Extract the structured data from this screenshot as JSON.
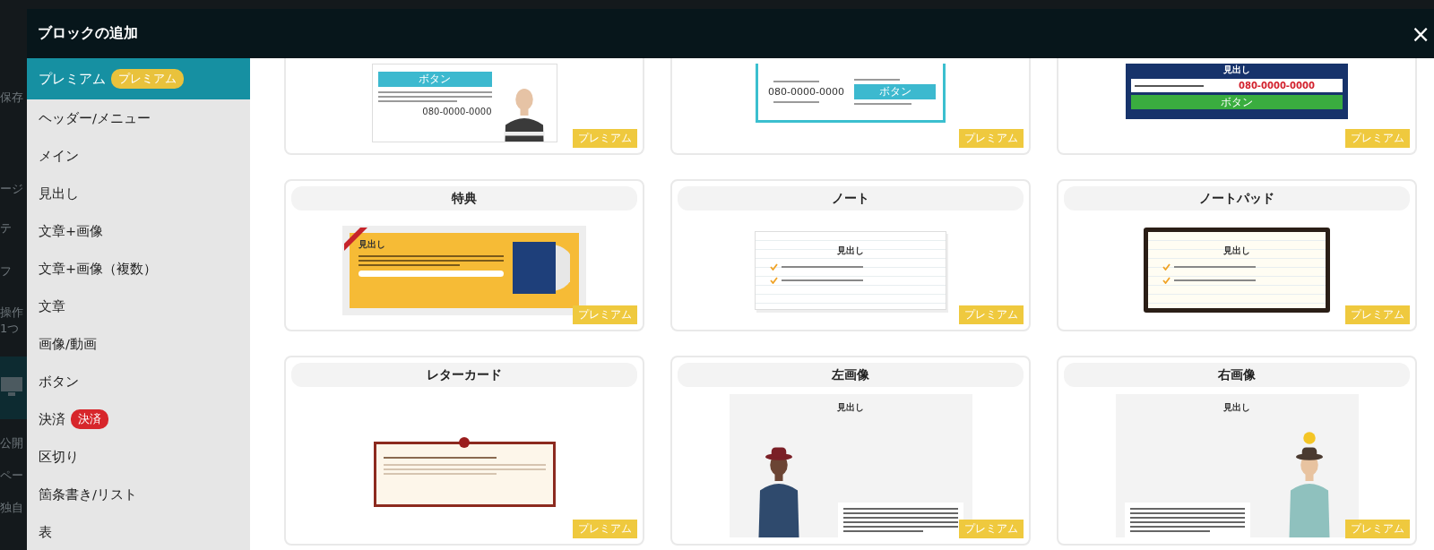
{
  "background_sidebar": {
    "items": [
      {
        "label": "保存"
      },
      {
        "label": "ージ"
      },
      {
        "label": "テ"
      },
      {
        "label": "フ"
      },
      {
        "label": "操作"
      },
      {
        "label": "1つ"
      },
      {
        "label": "公開"
      },
      {
        "label": "ペー"
      },
      {
        "label": "独自"
      }
    ]
  },
  "modal": {
    "title": "ブロックの追加",
    "close": "×"
  },
  "sidebar": {
    "items": [
      {
        "label": "プレミアム",
        "selected": true,
        "badge": {
          "text": "プレミアム",
          "color": "#e9c23c"
        }
      },
      {
        "label": "ヘッダー/メニュー",
        "selected": false
      },
      {
        "label": "メイン",
        "selected": false
      },
      {
        "label": "見出し",
        "selected": false
      },
      {
        "label": "文章+画像",
        "selected": false
      },
      {
        "label": "文章+画像（複数）",
        "selected": false
      },
      {
        "label": "文章",
        "selected": false
      },
      {
        "label": "画像/動画",
        "selected": false
      },
      {
        "label": "ボタン",
        "selected": false
      },
      {
        "label": "決済",
        "selected": false,
        "badge": {
          "text": "決済",
          "color": "#d7262b"
        }
      },
      {
        "label": "区切り",
        "selected": false
      },
      {
        "label": "箇条書き/リスト",
        "selected": false
      },
      {
        "label": "表",
        "selected": false
      }
    ]
  },
  "cards": [
    {
      "kind": "contact-photo",
      "button": "ボタン",
      "phone": "080-0000-0000",
      "badge": "プレミアム"
    },
    {
      "kind": "contact-box",
      "phone": "080-0000-0000",
      "button": "ボタン",
      "badge": "プレミアム"
    },
    {
      "kind": "navy-cta",
      "heading": "見出し",
      "phone": "080-0000-0000",
      "button": "ボタン",
      "badge": "プレミアム"
    },
    {
      "kind": "bonus",
      "title": "特典",
      "heading": "見出し",
      "badge": "プレミアム"
    },
    {
      "kind": "note",
      "title": "ノート",
      "heading": "見出し",
      "badge": "プレミアム"
    },
    {
      "kind": "notepad",
      "title": "ノートパッド",
      "heading": "見出し",
      "badge": "プレミアム"
    },
    {
      "kind": "letter",
      "title": "レターカード",
      "badge": "プレミアム"
    },
    {
      "kind": "left-image",
      "title": "左画像",
      "heading": "見出し",
      "badge": "プレミアム"
    },
    {
      "kind": "right-image",
      "title": "右画像",
      "heading": "見出し",
      "badge": "プレミアム"
    }
  ]
}
